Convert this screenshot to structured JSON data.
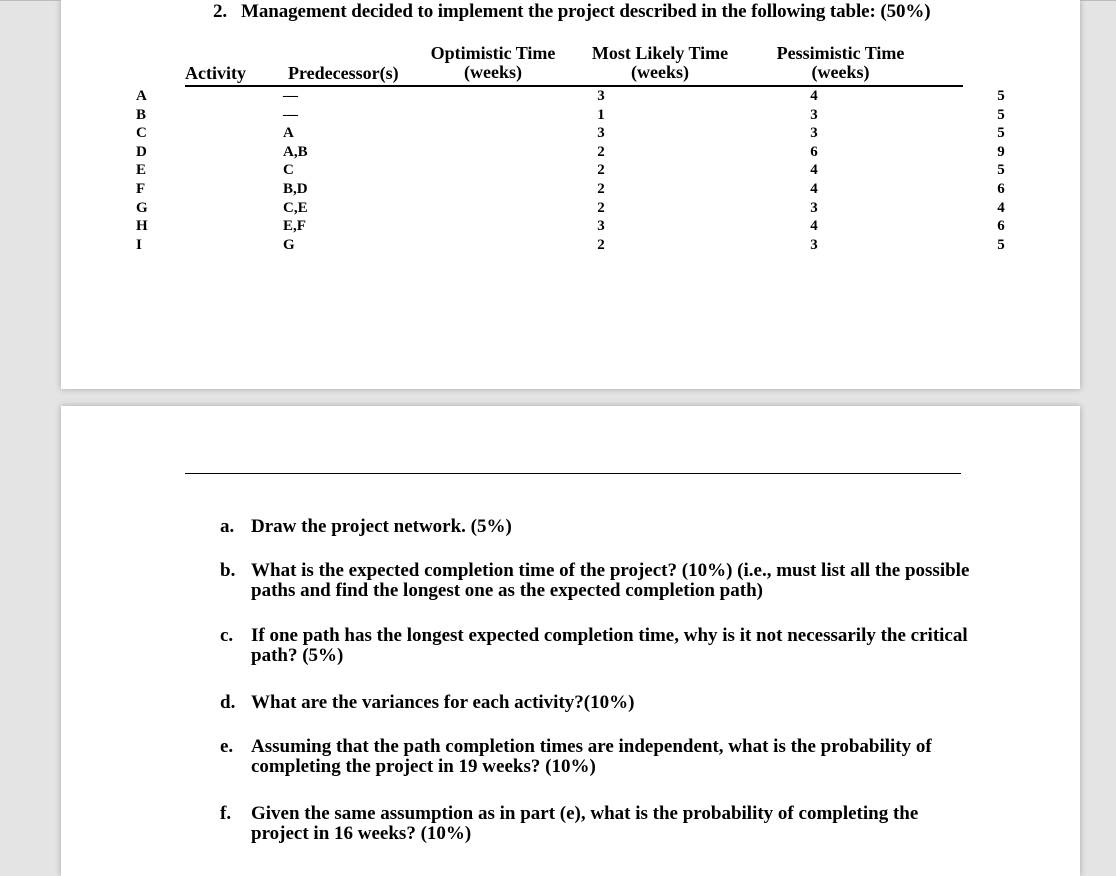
{
  "question": {
    "number": "2.",
    "title": "Management decided to implement the project described in the following table: (50%)"
  },
  "table": {
    "headers": {
      "activity": "Activity",
      "predecessors": "Predecessor(s)",
      "optimistic_line1": "Optimistic Time",
      "optimistic_line2": "(weeks)",
      "most_likely_line1": "Most Likely Time",
      "most_likely_line2": "(weeks)",
      "pessimistic_line1": "Pessimistic Time",
      "pessimistic_line2": "(weeks)"
    },
    "rows": [
      {
        "activity": "A",
        "predecessors": "—",
        "optimistic": "3",
        "most_likely": "4",
        "pessimistic": "5"
      },
      {
        "activity": "B",
        "predecessors": "—",
        "optimistic": "1",
        "most_likely": "3",
        "pessimistic": "5"
      },
      {
        "activity": "C",
        "predecessors": "A",
        "optimistic": "3",
        "most_likely": "3",
        "pessimistic": "5"
      },
      {
        "activity": "D",
        "predecessors": "A,B",
        "optimistic": "2",
        "most_likely": "6",
        "pessimistic": "9"
      },
      {
        "activity": "E",
        "predecessors": "C",
        "optimistic": "2",
        "most_likely": "4",
        "pessimistic": "5"
      },
      {
        "activity": "F",
        "predecessors": "B,D",
        "optimistic": "2",
        "most_likely": "4",
        "pessimistic": "6"
      },
      {
        "activity": "G",
        "predecessors": "C,E",
        "optimistic": "2",
        "most_likely": "3",
        "pessimistic": "4"
      },
      {
        "activity": "H",
        "predecessors": "E,F",
        "optimistic": "3",
        "most_likely": "4",
        "pessimistic": "6"
      },
      {
        "activity": "I",
        "predecessors": "G",
        "optimistic": "2",
        "most_likely": "3",
        "pessimistic": "5"
      }
    ]
  },
  "parts": [
    {
      "label": "a.",
      "text": "Draw the project network. (5%)"
    },
    {
      "label": "b.",
      "text": "What is the expected completion time of the project? (10%) (i.e., must list all the possible paths and find the longest one as the expected completion path)"
    },
    {
      "label": "c.",
      "text": "If one path has the longest expected completion time, why is it not necessarily the critical path? (5%)"
    },
    {
      "label": "d.",
      "text": "What are the variances for each activity?(10%)"
    },
    {
      "label": "e.",
      "text": "Assuming that the path completion times are independent, what is the probability of completing the project in 19 weeks? (10%)"
    },
    {
      "label": "f.",
      "text": "Given the same assumption as in part (e), what is the probability of completing the project in 16 weeks? (10%)"
    }
  ]
}
